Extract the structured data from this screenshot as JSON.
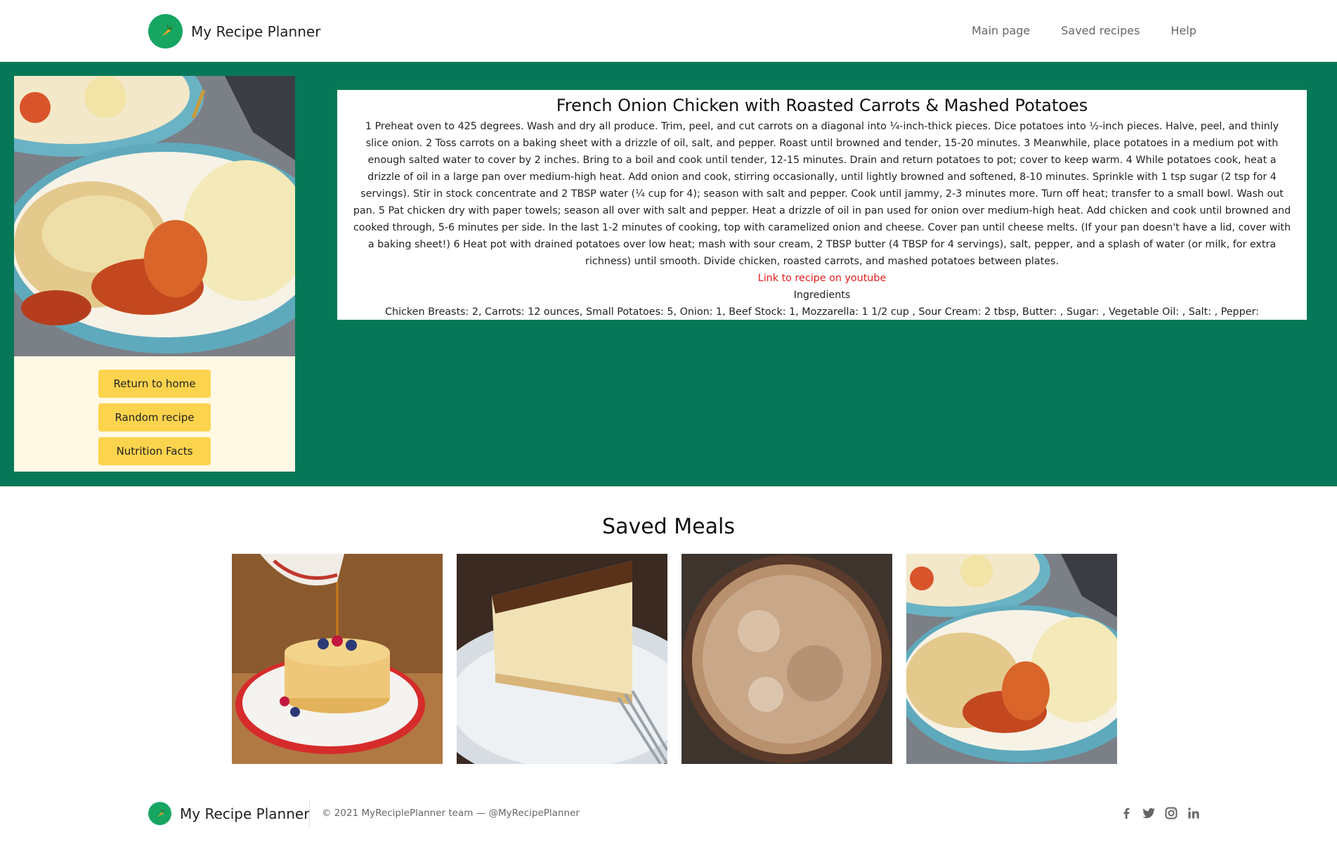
{
  "nav": {
    "brand": "My Recipe Planner",
    "links": [
      "Main page",
      "Saved recipes",
      "Help"
    ]
  },
  "sidebar": {
    "buttons": [
      "Return to home",
      "Random recipe",
      "Nutrition Facts"
    ]
  },
  "recipe": {
    "title": "French Onion Chicken with Roasted Carrots & Mashed Potatoes",
    "instructions": "1 Preheat oven to 425 degrees. Wash and dry all produce. Trim, peel, and cut carrots on a diagonal into ¼-inch-thick pieces. Dice potatoes into ½-inch pieces. Halve, peel, and thinly slice onion. 2 Toss carrots on a baking sheet with a drizzle of oil, salt, and pepper. Roast until browned and tender, 15-20 minutes. 3 Meanwhile, place potatoes in a medium pot with enough salted water to cover by 2 inches. Bring to a boil and cook until tender, 12-15 minutes. Drain and return potatoes to pot; cover to keep warm. 4 While potatoes cook, heat a drizzle of oil in a large pan over medium-high heat. Add onion and cook, stirring occasionally, until lightly browned and softened, 8-10 minutes. Sprinkle with 1 tsp sugar (2 tsp for 4 servings). Stir in stock concentrate and 2 TBSP water (¼ cup for 4); season with salt and pepper. Cook until jammy, 2-3 minutes more. Turn off heat; transfer to a small bowl. Wash out pan. 5 Pat chicken dry with paper towels; season all over with salt and pepper. Heat a drizzle of oil in pan used for onion over medium-high heat. Add chicken and cook until browned and cooked through, 5-6 minutes per side. In the last 1-2 minutes of cooking, top with caramelized onion and cheese. Cover pan until cheese melts. (If your pan doesn't have a lid, cover with a baking sheet!) 6 Heat pot with drained potatoes over low heat; mash with sour cream, 2 TBSP butter (4 TBSP for 4 servings), salt, pepper, and a splash of water (or milk, for extra richness) until smooth. Divide chicken, roasted carrots, and mashed potatoes between plates.",
    "link_text": "Link to recipe on youtube",
    "ingredients_heading": "Ingredients",
    "ingredients": "Chicken Breasts: 2, Carrots: 12 ounces, Small Potatoes: 5, Onion: 1, Beef Stock: 1, Mozzarella: 1 1/2 cup , Sour Cream: 2 tbsp, Butter: , Sugar: , Vegetable Oil: , Salt: , Pepper:"
  },
  "saved": {
    "title": "Saved Meals"
  },
  "footer": {
    "brand": "My Recipe Planner",
    "copyright": "© 2021 MyReciplePlanner team — ",
    "handle": "@MyRecipePlanner",
    "socials": [
      "facebook-icon",
      "twitter-icon",
      "instagram-icon",
      "linkedin-icon"
    ]
  },
  "colors": {
    "hero_bg": "#077857",
    "button_bg": "#fcd34d",
    "sidebar_bg": "#fff8e4",
    "link": "#e11d1d",
    "logo": "#17a562"
  }
}
